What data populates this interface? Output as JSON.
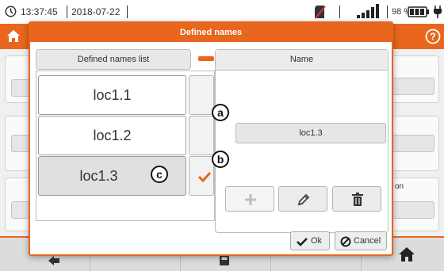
{
  "status_bar": {
    "time": "13:37:45",
    "date": "2018-07-22",
    "battery_percent": "98 %",
    "icons": [
      "clock-icon",
      "sd-card-icon",
      "signal-bars-icon",
      "battery-icon",
      "power-plug-icon"
    ]
  },
  "background": {
    "icons": [
      "home-icon",
      "help-icon",
      "back-arrow-icon",
      "save-icon",
      "home-icon"
    ],
    "partial_label": "on"
  },
  "dialog": {
    "title": "Defined names",
    "list": {
      "header": "Defined names list",
      "items": [
        {
          "label": "loc1.1",
          "selected": false
        },
        {
          "label": "loc1.2",
          "selected": false
        },
        {
          "label": "loc1.3",
          "selected": true
        }
      ]
    },
    "name_panel": {
      "header": "Name",
      "value": "loc1.3",
      "actions": [
        {
          "icon": "plus-icon",
          "enabled": false
        },
        {
          "icon": "pencil-icon",
          "enabled": true
        },
        {
          "icon": "trash-icon",
          "enabled": true
        }
      ]
    },
    "buttons": {
      "ok": "Ok",
      "cancel": "Cancel"
    }
  },
  "markers": {
    "a": "a",
    "b": "b",
    "c": "c"
  },
  "colors": {
    "accent": "#e8661e",
    "check": "#e8661e"
  }
}
